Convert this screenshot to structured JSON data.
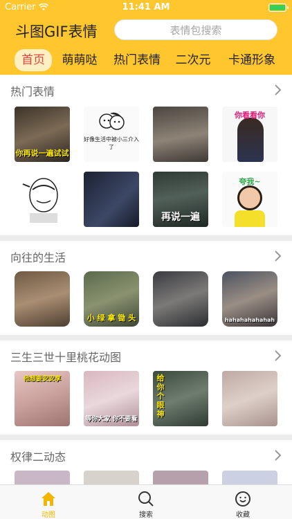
{
  "status_bar": {
    "carrier": "Carrier",
    "time": "11:41 AM"
  },
  "header": {
    "title": "斗图GIF表情",
    "search_placeholder": "表情包搜索",
    "tabs": [
      {
        "label": "首页",
        "active": true
      },
      {
        "label": "萌萌哒"
      },
      {
        "label": "热门表情"
      },
      {
        "label": "二次元"
      },
      {
        "label": "卡通形象"
      }
    ]
  },
  "sections": [
    {
      "title": "热门表情",
      "items": [
        {
          "caption": "你再说一遍试试"
        },
        {
          "caption": "好像生活中被小三介入了"
        },
        {
          "caption": ""
        },
        {
          "caption": "你看看你"
        },
        {
          "caption": ""
        },
        {
          "caption": ""
        },
        {
          "caption": "再说一遍"
        },
        {
          "caption": "夸我~"
        }
      ]
    },
    {
      "title": "向往的生活",
      "items": [
        {
          "caption": ""
        },
        {
          "caption": "小 绿 拿 锄 头"
        },
        {
          "caption": ""
        },
        {
          "caption": "hahahahahahah"
        }
      ]
    },
    {
      "title": "三生三世十里桃花动图",
      "items": [
        {
          "caption": "他想要安安享"
        },
        {
          "caption": "等你大家 你不要看"
        },
        {
          "caption": "给你个眼神"
        },
        {
          "caption": ""
        }
      ]
    },
    {
      "title": "权律二动态",
      "items": [
        {},
        {},
        {},
        {}
      ]
    }
  ],
  "tab_bar": [
    {
      "label": "动图",
      "icon": "home-icon",
      "active": true
    },
    {
      "label": "搜索",
      "icon": "search-icon"
    },
    {
      "label": "收藏",
      "icon": "favorites-icon"
    }
  ],
  "colors": {
    "brand_yellow": "#ffc62e",
    "active_tab_text": "#e0443c",
    "tabbar_active": "#f3b500"
  }
}
